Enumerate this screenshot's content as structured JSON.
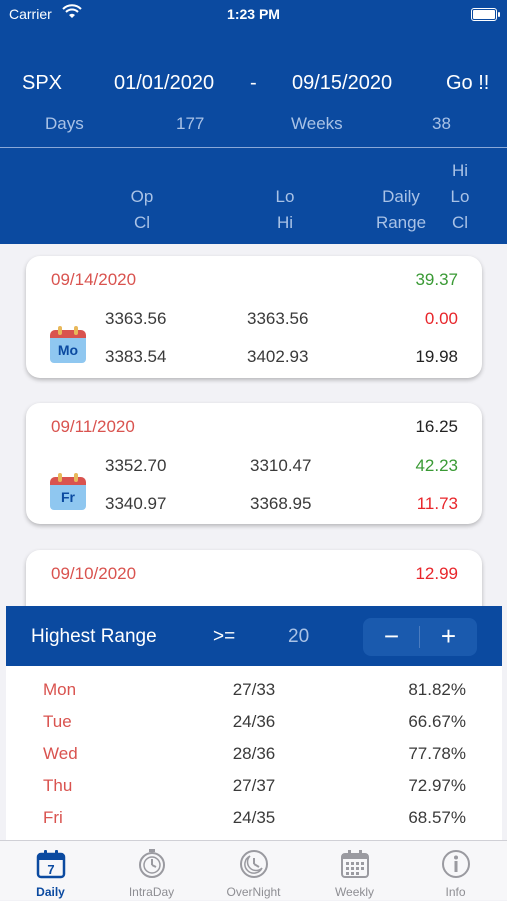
{
  "status_bar": {
    "carrier": "Carrier",
    "time": "1:23 PM"
  },
  "query": {
    "symbol": "SPX",
    "start_date": "01/01/2020",
    "separator": "-",
    "end_date": "09/15/2020",
    "go_label": "Go !!",
    "days_label": "Days",
    "days_value": "177",
    "weeks_label": "Weeks",
    "weeks_value": "38"
  },
  "columns": {
    "col1_line1": "Op",
    "col1_line2": "Cl",
    "col2_line1": "Lo",
    "col2_line2": "Hi",
    "col3_line1": "Daily",
    "col3_line2": "Range",
    "col4_line1": "Hi",
    "col4_line2": "Lo",
    "col4_line3": "Cl"
  },
  "cards": [
    {
      "date": "09/14/2020",
      "day_badge": "Mo",
      "open": "3363.56",
      "low": "3363.56",
      "close": "3383.54",
      "high": "3402.93",
      "v1": "39.37",
      "v2": "0.00",
      "v3": "19.98",
      "v1_color": "#3a9a35",
      "v2_color": "#e8262b",
      "v3_color": "#222222"
    },
    {
      "date": "09/11/2020",
      "day_badge": "Fr",
      "open": "3352.70",
      "low": "3310.47",
      "close": "3340.97",
      "high": "3368.95",
      "v1": "16.25",
      "v2": "42.23",
      "v3": "11.73",
      "v1_color": "#222222",
      "v2_color": "#3a9a35",
      "v3_color": "#e8262b"
    },
    {
      "date": "09/10/2020",
      "v1": "12.99",
      "v1_color": "#e8262b"
    }
  ],
  "range": {
    "title": "Highest Range",
    "operator": ">=",
    "threshold": "20",
    "minus_label": "−",
    "plus_label": "+",
    "rows": [
      {
        "day": "Mon",
        "ratio": "27/33",
        "pct": "81.82%"
      },
      {
        "day": "Tue",
        "ratio": "24/36",
        "pct": "66.67%"
      },
      {
        "day": "Wed",
        "ratio": "28/36",
        "pct": "77.78%"
      },
      {
        "day": "Thu",
        "ratio": "27/37",
        "pct": "72.97%"
      },
      {
        "day": "Fri",
        "ratio": "24/35",
        "pct": "68.57%"
      }
    ]
  },
  "tabs": [
    {
      "label": "Daily",
      "icon": "calendar-icon",
      "calendar_day": "7",
      "active": true
    },
    {
      "label": "IntraDay",
      "icon": "timer-icon",
      "active": false
    },
    {
      "label": "OverNight",
      "icon": "night-clock-icon",
      "active": false
    },
    {
      "label": "Weekly",
      "icon": "weekly-calendar-icon",
      "active": false
    },
    {
      "label": "Info",
      "icon": "info-icon",
      "active": false
    }
  ],
  "colors": {
    "primary": "#0b4aa0",
    "date_red": "#d9534f",
    "up_green": "#3a9a35",
    "down_red": "#e8262b"
  }
}
